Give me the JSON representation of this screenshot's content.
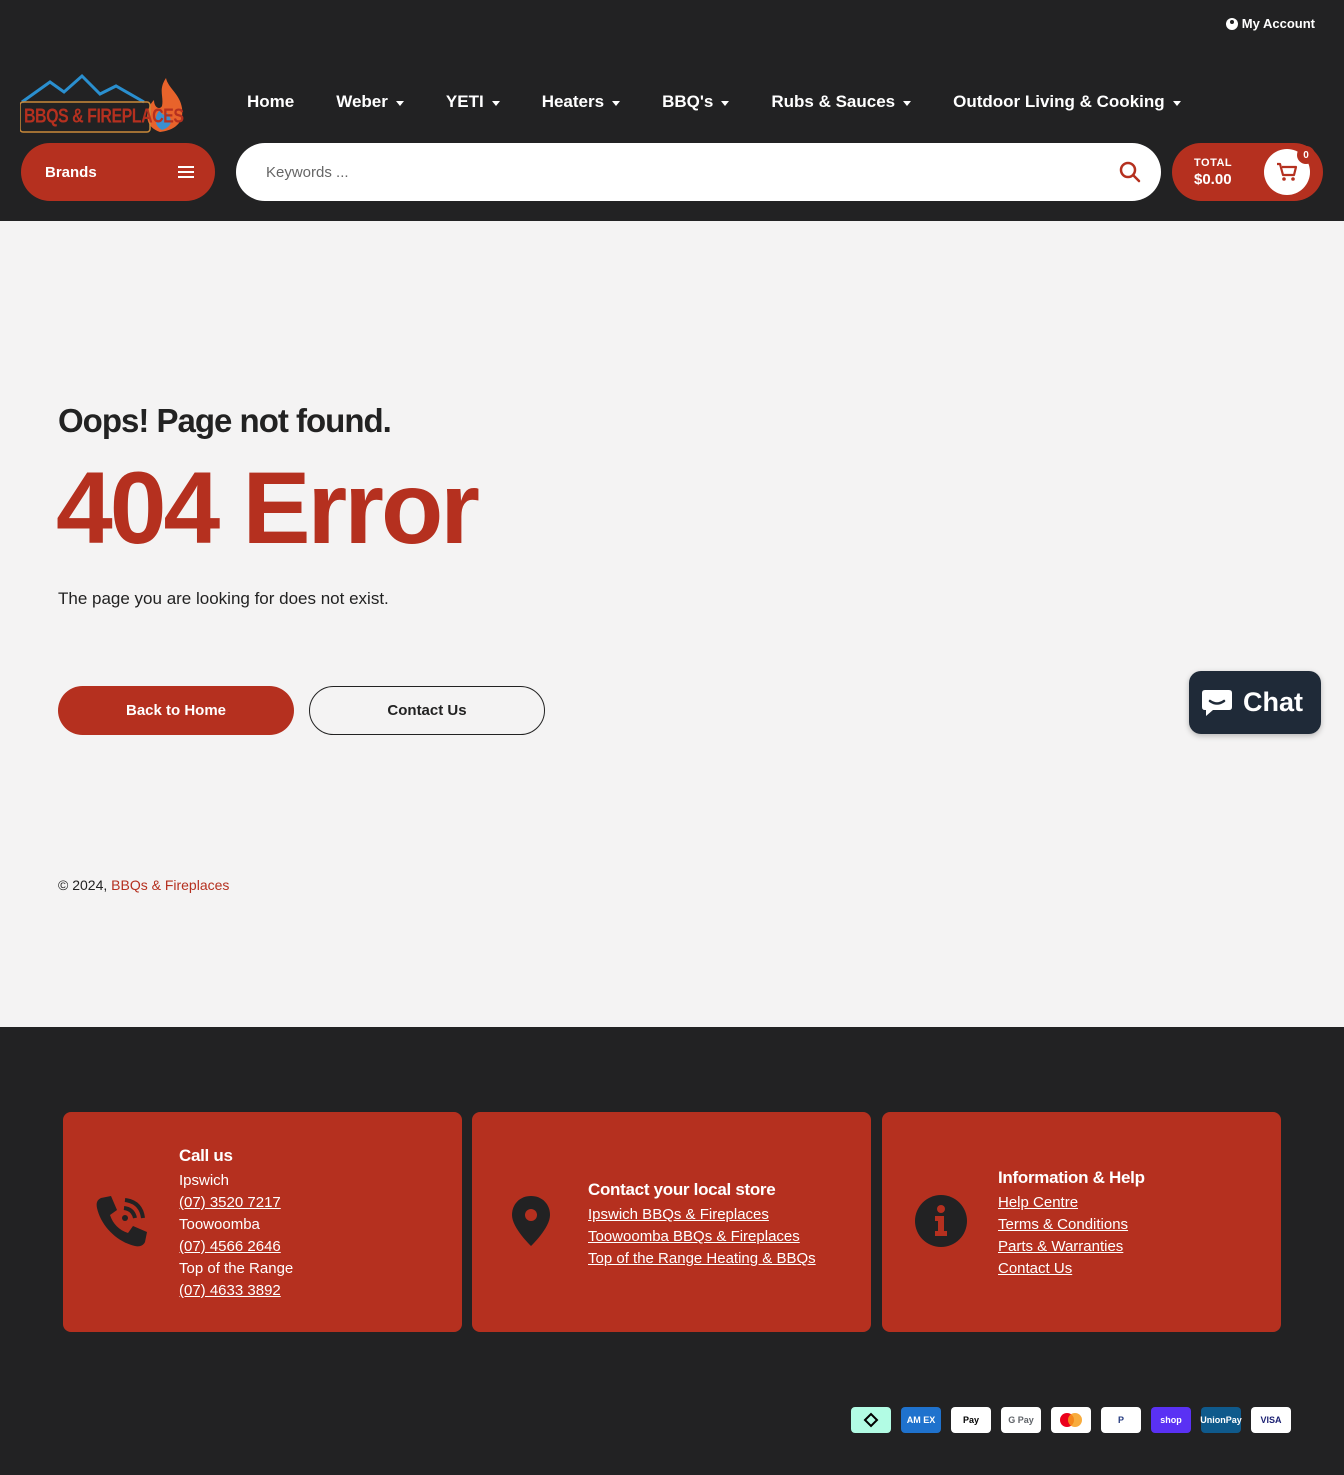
{
  "header": {
    "account_label": "My Account",
    "logo_text": "BBQS & FIREPLACES",
    "nav": [
      {
        "label": "Home",
        "has_caret": false
      },
      {
        "label": "Weber",
        "has_caret": true
      },
      {
        "label": "YETI",
        "has_caret": true
      },
      {
        "label": "Heaters",
        "has_caret": true
      },
      {
        "label": "BBQ's",
        "has_caret": true
      },
      {
        "label": "Rubs & Sauces",
        "has_caret": true
      },
      {
        "label": "Outdoor Living & Cooking",
        "has_caret": true
      }
    ],
    "brands_label": "Brands",
    "search_placeholder": "Keywords ...",
    "cart": {
      "total_label": "TOTAL",
      "total_value": "$0.00",
      "count": "0"
    }
  },
  "main": {
    "subtitle": "Oops! Page not found.",
    "title": "404 Error",
    "description": "The page you are looking for does not exist.",
    "back_home_label": "Back to Home",
    "contact_label": "Contact Us",
    "copyright_prefix": "© 2024,",
    "copyright_link": "BBQs & Fireplaces"
  },
  "chat": {
    "label": "Chat"
  },
  "footer": {
    "call": {
      "title": "Call us",
      "lines": [
        {
          "text": "Ipswich",
          "link": false
        },
        {
          "text": "(07) 3520 7217",
          "link": true
        },
        {
          "text": "Toowoomba",
          "link": false
        },
        {
          "text": "(07) 4566 2646",
          "link": true
        },
        {
          "text": "Top of the Range",
          "link": false
        },
        {
          "text": "(07) 4633 3892",
          "link": true
        }
      ]
    },
    "stores": {
      "title": "Contact your local store",
      "links": [
        "Ipswich BBQs & Fireplaces",
        "Toowoomba BBQs & Fireplaces",
        "Top of the Range Heating & BBQs"
      ]
    },
    "info": {
      "title": "Information & Help",
      "links": [
        "Help Centre",
        "Terms & Conditions",
        "Parts & Warranties",
        "Contact Us"
      ]
    },
    "payments": [
      {
        "name": "afterpay-icon",
        "label": "",
        "bg": "#b2fce4",
        "fg": "#000"
      },
      {
        "name": "amex-icon",
        "label": "AM EX",
        "bg": "#1f72cd",
        "fg": "#fff"
      },
      {
        "name": "apple-pay-icon",
        "label": "Pay",
        "bg": "#fff",
        "fg": "#000"
      },
      {
        "name": "google-pay-icon",
        "label": "G Pay",
        "bg": "#fff",
        "fg": "#5f6368"
      },
      {
        "name": "mastercard-icon",
        "label": "",
        "bg": "#fff",
        "fg": "#000"
      },
      {
        "name": "paypal-icon",
        "label": "P",
        "bg": "#fff",
        "fg": "#253b80"
      },
      {
        "name": "shop-pay-icon",
        "label": "shop",
        "bg": "#5a31f4",
        "fg": "#fff"
      },
      {
        "name": "unionpay-icon",
        "label": "UnionPay",
        "bg": "#0f5a8c",
        "fg": "#fff"
      },
      {
        "name": "visa-icon",
        "label": "VISA",
        "bg": "#fff",
        "fg": "#1a1f71"
      }
    ]
  },
  "colors": {
    "brand_red": "#b5301f",
    "dark": "#222223",
    "chat_bg": "#1f2a38"
  }
}
